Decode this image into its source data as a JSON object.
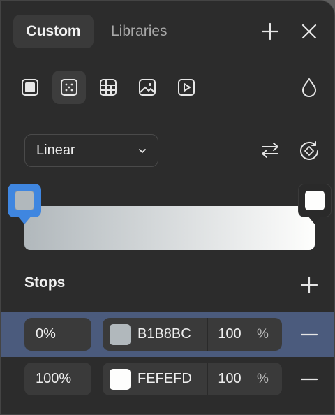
{
  "tabs": [
    {
      "label": "Custom",
      "active": true
    },
    {
      "label": "Libraries",
      "active": false
    }
  ],
  "header_icons": [
    "plus-icon",
    "close-icon"
  ],
  "fill_types": [
    "solid-fill-icon",
    "gradient-fill-icon",
    "pattern-fill-icon",
    "image-fill-icon",
    "video-fill-icon"
  ],
  "opacity_icon": "droplet-icon",
  "gradient": {
    "type_label": "Linear",
    "icons": [
      "swap-icon",
      "rotate-icon"
    ]
  },
  "stops": {
    "label": "Stops",
    "items": [
      {
        "position": "0%",
        "hex": "B1B8BC",
        "color": "#B1B8BC",
        "opacity": "100",
        "unit": "%",
        "selected": true
      },
      {
        "position": "100%",
        "hex": "FEFEFD",
        "color": "#FEFEFD",
        "opacity": "100",
        "unit": "%",
        "selected": false
      }
    ]
  },
  "colors": {
    "accent": "#3f86e0",
    "panel_bg": "#2c2c2c",
    "selected_row": "#4b5b7d"
  }
}
